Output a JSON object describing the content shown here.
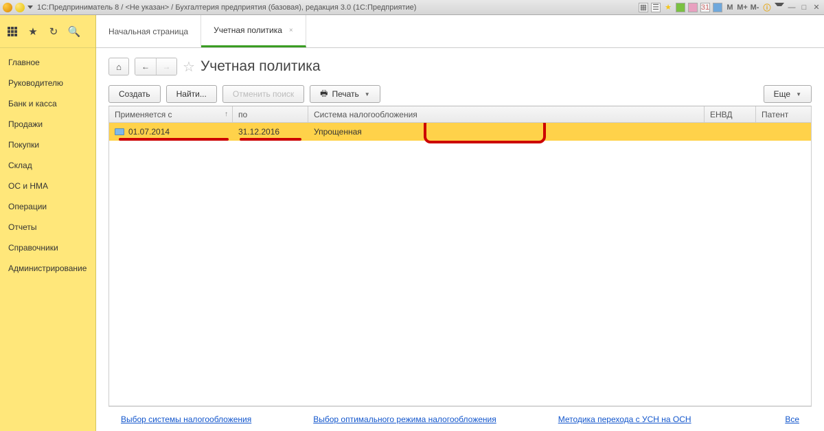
{
  "titlebar": {
    "text": "1С:Предприниматель 8 / <Не указан> / Бухгалтерия предприятия (базовая), редакция 3.0  (1С:Предприятие)"
  },
  "sidebar": {
    "items": [
      {
        "label": "Главное"
      },
      {
        "label": "Руководителю"
      },
      {
        "label": "Банк и касса"
      },
      {
        "label": "Продажи"
      },
      {
        "label": "Покупки"
      },
      {
        "label": "Склад"
      },
      {
        "label": "ОС и НМА"
      },
      {
        "label": "Операции"
      },
      {
        "label": "Отчеты"
      },
      {
        "label": "Справочники"
      },
      {
        "label": "Администрирование"
      }
    ]
  },
  "tabs": [
    {
      "label": "Начальная страница"
    },
    {
      "label": "Учетная политика",
      "active": true
    }
  ],
  "page": {
    "title": "Учетная политика",
    "buttons": {
      "create": "Создать",
      "find": "Найти...",
      "cancel_search": "Отменить поиск",
      "print": "Печать",
      "more": "Еще"
    },
    "columns": {
      "c0": "Применяется с",
      "c1": "по",
      "c2": "Система налогообложения",
      "c3": "ЕНВД",
      "c4": "Патент"
    },
    "rows": [
      {
        "date_from": "01.07.2014",
        "date_to": "31.12.2016",
        "system": "Упрощенная",
        "envd": "",
        "patent": ""
      }
    ],
    "sort_indicator": "↑"
  },
  "footer": {
    "link1": "Выбор системы налогообложения",
    "link2": "Выбор оптимального режима налогообложения",
    "link3": "Методика перехода с УСН на ОСН",
    "link4": "Все"
  }
}
